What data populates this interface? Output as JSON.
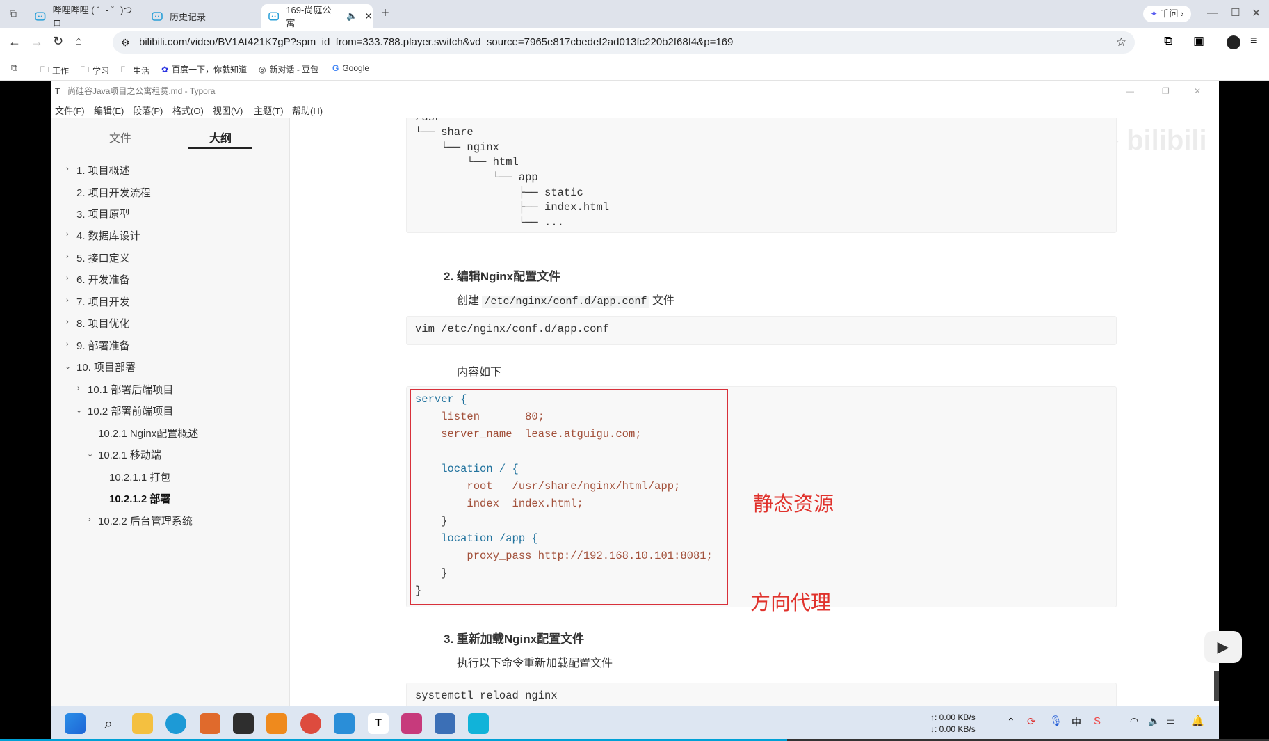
{
  "browser": {
    "tabs": [
      {
        "label": "哔哩哔哩 ( ゜- ゜)つロ"
      },
      {
        "label": "历史记录"
      },
      {
        "label": "169-尚庭公寓"
      }
    ],
    "assistant_label": "千问",
    "url": "bilibili.com/video/BV1At421K7gP?spm_id_from=333.788.player.switch&vd_source=7965e817cbedef2ad013fc220b2f68f4&p=169",
    "bookmarks": [
      "工作",
      "学习",
      "生活",
      "百度一下，你就知道",
      "新对话 - 豆包",
      "Google"
    ]
  },
  "typora": {
    "title": "尚硅谷Java项目之公寓租赁.md - Typora",
    "menu": [
      "文件(F)",
      "编辑(E)",
      "段落(P)",
      "格式(O)",
      "视图(V)",
      "主题(T)",
      "帮助(H)"
    ],
    "side_tabs": {
      "files": "文件",
      "outline": "大纲"
    },
    "outline": [
      "1. 项目概述",
      "2. 项目开发流程",
      "3. 项目原型",
      "4. 数据库设计",
      "5. 接口定义",
      "6. 开发准备",
      "7. 项目开发",
      "8. 项目优化",
      "9. 部署准备",
      "10. 项目部署",
      "10.1 部署后端项目",
      "10.2 部署前端项目",
      "10.2.1 Nginx配置概述",
      "10.2.1 移动端",
      "10.2.1.1 打包",
      "10.2.1.2 部署",
      "10.2.2 后台管理系统"
    ],
    "watermark": "尚硅谷 bilibili",
    "tree_lines": [
      "/usr",
      "└── share",
      "    └── nginx",
      "        └── html",
      "            └── app",
      "                ├── static",
      "                ├── index.html",
      "                └── ..."
    ],
    "step2_heading": "2. 编辑Nginx配置文件",
    "step2_text_pre": "创建",
    "step2_path": "/etc/nginx/conf.d/app.conf",
    "step2_text_post": "文件",
    "vim_cmd": "vim /etc/nginx/conf.d/app.conf",
    "content_label": "内容如下",
    "nginx_conf": [
      "server {",
      "    listen       80;",
      "    server_name  lease.atguigu.com;",
      "",
      "    location / {",
      "        root   /usr/share/nginx/html/app;",
      "        index  index.html;",
      "    }",
      "    location /app {",
      "        proxy_pass http://192.168.10.101:8081;",
      "    }",
      "}"
    ],
    "annotation_static": "静态资源",
    "annotation_proxy": "方向代理",
    "step3_heading": "3. 重新加载Nginx配置文件",
    "step3_text": "执行以下命令重新加载配置文件",
    "reload_cmd": "systemctl reload nginx"
  },
  "taskbar": {
    "upload": "↑: 0.00 KB/s",
    "download": "↓: 0.00 KB/s"
  }
}
